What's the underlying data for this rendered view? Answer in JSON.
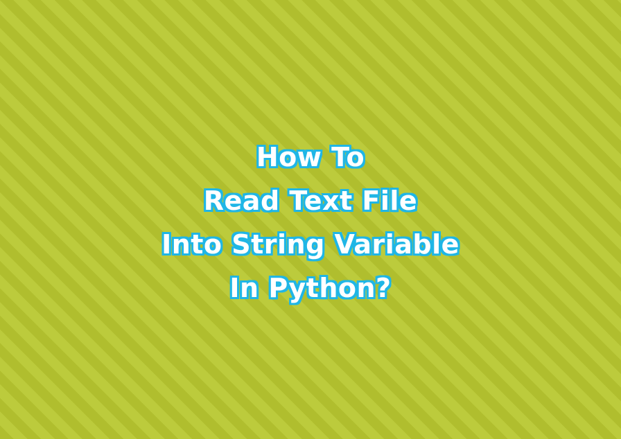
{
  "colors": {
    "background": "#b4c232",
    "stripe_dark": "#b0be2e",
    "stripe_light": "#bccb3c",
    "title_fill": "#ffffff",
    "title_outline": "#1fb6e6"
  },
  "title": {
    "lines": [
      "How To",
      "Read Text File",
      "Into String Variable",
      "In Python?"
    ]
  }
}
